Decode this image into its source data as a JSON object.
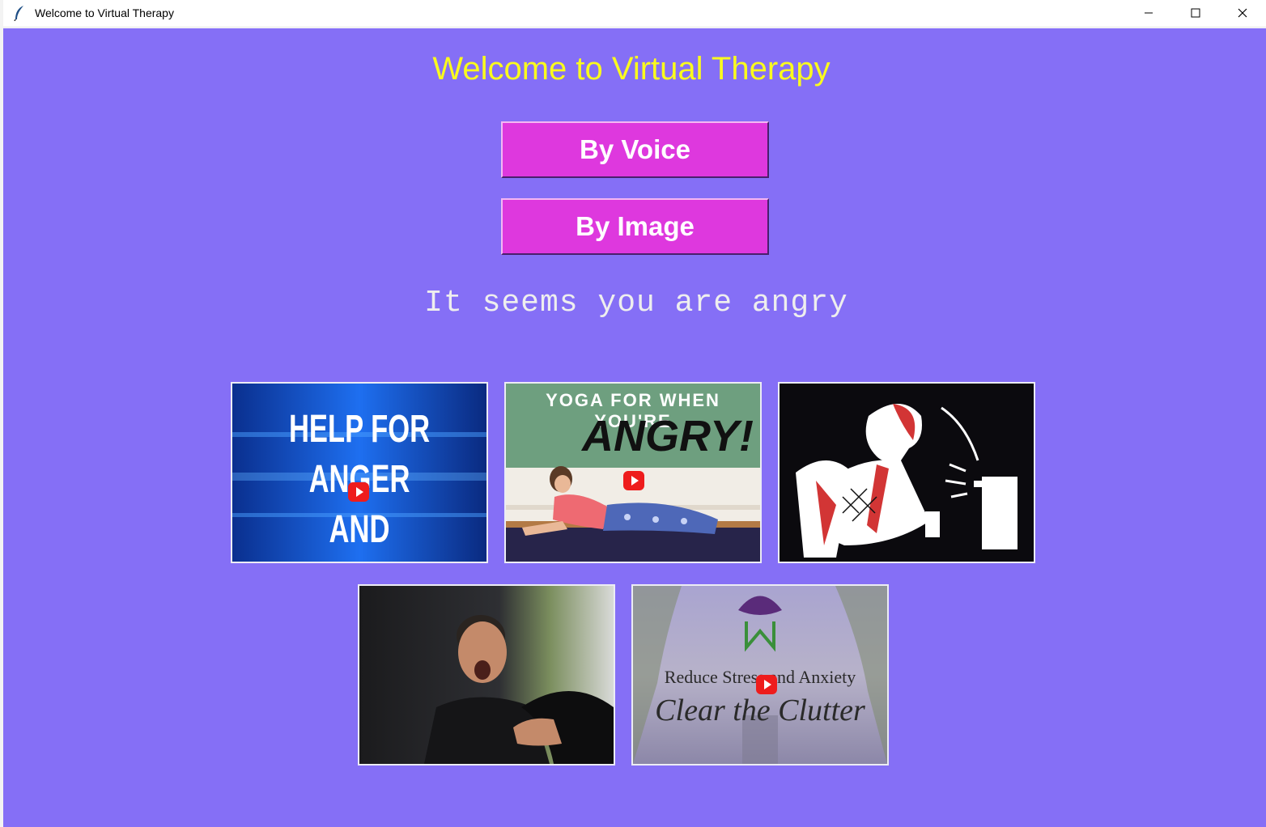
{
  "window": {
    "title": "Welcome to Virtual Therapy",
    "icon": "feather-icon"
  },
  "main": {
    "heading": "Welcome to Virtual Therapy",
    "buttons": {
      "voice": "By Voice",
      "image": "By Image"
    },
    "status": "It seems you are angry"
  },
  "videos": [
    {
      "lines": [
        "HELP FOR",
        "ANGER",
        "AND ANXIETY"
      ]
    },
    {
      "top": "YOGA FOR WHEN YOU'RE",
      "big": "ANGRY!"
    },
    {
      "lines": []
    },
    {
      "lines": []
    },
    {
      "line1": "Reduce Stress and Anxiety",
      "line2": "Clear the Clutter"
    }
  ],
  "colors": {
    "background": "#856ff6",
    "heading": "#fafa1e",
    "button": "#de38de",
    "status_text": "#eeeeee"
  }
}
